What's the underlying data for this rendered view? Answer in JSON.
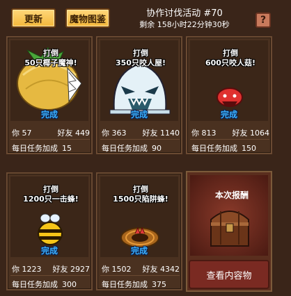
{
  "header": {
    "update_label": "更新",
    "bestiary_label": "魔物图鉴",
    "event_title": "协作讨伐活动 #70",
    "remaining": "剩余 158小时22分钟30秒",
    "help_label": "?"
  },
  "quests": [
    {
      "defeat": "打倒",
      "target": "50只椰子魔神!",
      "status": "完成",
      "you_label": "你",
      "you": "57",
      "friends_label": "好友",
      "friends": "449",
      "bonus_label": "每日任务加成",
      "bonus": "15"
    },
    {
      "defeat": "打倒",
      "target": "350只咬人屋!",
      "status": "完成",
      "you_label": "你",
      "you": "363",
      "friends_label": "好友",
      "friends": "1140",
      "bonus_label": "每日任务加成",
      "bonus": "90"
    },
    {
      "defeat": "打倒",
      "target": "600只咬人菇!",
      "status": "完成",
      "you_label": "你",
      "you": "813",
      "friends_label": "好友",
      "friends": "1064",
      "bonus_label": "每日任务加成",
      "bonus": "150"
    },
    {
      "defeat": "打倒",
      "target": "1200只一击蜂!",
      "status": "完成",
      "you_label": "你",
      "you": "1223",
      "friends_label": "好友",
      "friends": "2927",
      "bonus_label": "每日任务加成",
      "bonus": "300"
    },
    {
      "defeat": "打倒",
      "target": "1500只陷阱蜂!",
      "status": "完成",
      "you_label": "你",
      "you": "1502",
      "friends_label": "好友",
      "friends": "4342",
      "bonus_label": "每日任务加成",
      "bonus": "375"
    }
  ],
  "reward": {
    "title": "本次报酬",
    "view_label": "查看内容物"
  }
}
